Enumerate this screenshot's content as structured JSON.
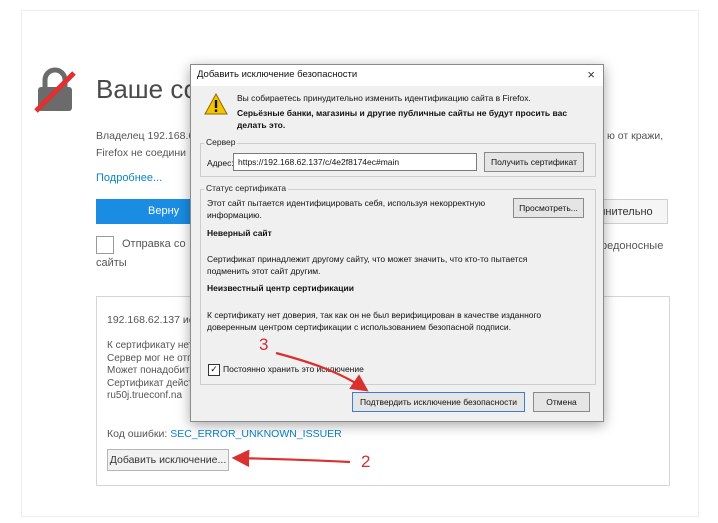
{
  "page": {
    "heading": "Ваше со",
    "intro_left_lines": [
      "Владелец 192.168.6",
      "Firefox не соедини"
    ],
    "intro_right_lines": [
      "ю от кражи,"
    ],
    "more_link": "Подробнее...",
    "go_back_label": "Верну",
    "advanced_label": "лнительно",
    "report_text": "Отправка со",
    "report_text_line2": "сайты",
    "report_text_right": "редоносные",
    "advanced_panel": {
      "host_line": "192.168.62.137 ис",
      "lines": [
        "К сертификату нет",
        "Сервер мог не отп",
        "Может понадобит",
        "Сертификат дейст",
        "ru50j.trueconf.na"
      ],
      "error_label": "Код ошибки: ",
      "error_code": "SEC_ERROR_UNKNOWN_ISSUER",
      "add_exception_label": "Добавить исключение..."
    }
  },
  "dialog": {
    "title": "Добавить исключение безопасности",
    "close": "×",
    "warning_line1": "Вы собираетесь принудительно изменить идентификацию сайта в Firefox.",
    "warning_line2": "Серьёзные банки, магазины и другие публичные сайты не будут просить вас делать это.",
    "server_group_label": "Сервер",
    "address_label": "Адрес:",
    "address_value": "https://192.168.62.137/c/4e2f8174ec#main",
    "get_cert_label": "Получить сертификат",
    "status_group_label": "Статус сертификата",
    "status_line1": "Этот сайт пытается идентифицировать себя, используя некорректную",
    "status_line2": "информацию.",
    "view_label": "Просмотреть...",
    "wrong_site_title": "Неверный сайт",
    "wrong_site_line1": "Сертификат принадлежит другому сайту, что может значить, что кто-то пытается",
    "wrong_site_line2": "подменить этот сайт другим.",
    "unknown_ca_title": "Неизвестный центр сертификации",
    "unknown_ca_line1": "К сертификату нет доверия, так как он не был верифицирован в качестве изданного",
    "unknown_ca_line2": "доверенным центром сертификации с использованием безопасной подписи.",
    "permanent_label": "Постоянно хранить это исключение",
    "permanent_checked": "✓",
    "confirm_label": "Подтвердить исключение безопасности",
    "cancel_label": "Отмена"
  },
  "annotations": {
    "step2": "2",
    "step3": "3",
    "arrow_color": "#d93030"
  },
  "icons": {
    "lock": "broken-lock-icon",
    "warning": "warning-triangle-icon"
  }
}
